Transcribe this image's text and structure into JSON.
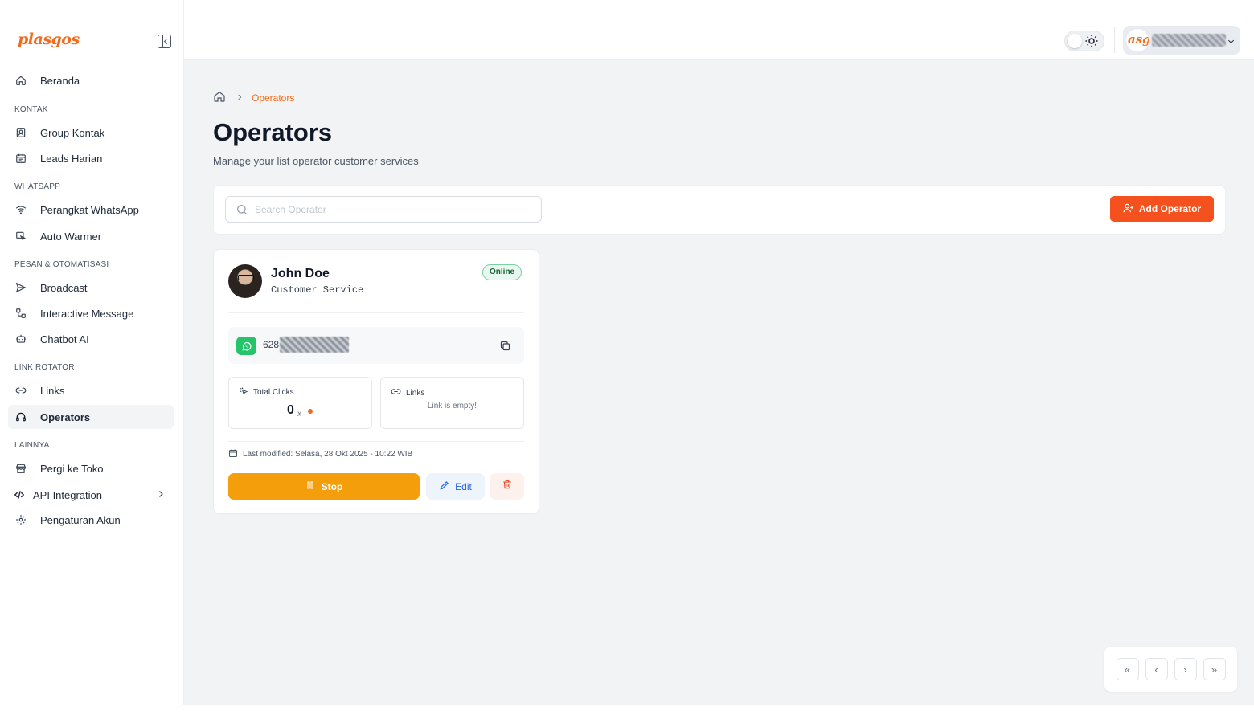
{
  "brand": "plasgos",
  "sidebar": {
    "items": [
      {
        "label": "Beranda",
        "icon": "home-icon"
      },
      {
        "section": "KONTAK"
      },
      {
        "label": "Group Kontak",
        "icon": "contact-icon"
      },
      {
        "label": "Leads Harian",
        "icon": "calendar-icon"
      },
      {
        "section": "WHATSAPP"
      },
      {
        "label": "Perangkat WhatsApp",
        "icon": "wifi-icon"
      },
      {
        "label": "Auto Warmer",
        "icon": "auto-warmer-icon"
      },
      {
        "section": "PESAN & OTOMATISASI"
      },
      {
        "label": "Broadcast",
        "icon": "send-icon"
      },
      {
        "label": "Interactive Message",
        "icon": "interactive-icon"
      },
      {
        "label": "Chatbot AI",
        "icon": "bot-icon"
      },
      {
        "section": "LINK ROTATOR"
      },
      {
        "label": "Links",
        "icon": "link-icon"
      },
      {
        "label": "Operators",
        "icon": "headset-icon",
        "active": true
      },
      {
        "section": "LAINNYA"
      },
      {
        "label": "Pergi ke Toko",
        "icon": "store-icon"
      },
      {
        "label": "API Integration",
        "icon": "code-icon"
      },
      {
        "label": "Pengaturan Akun",
        "icon": "settings-icon"
      }
    ]
  },
  "topbar": {
    "user_logo_text": "asg"
  },
  "breadcrumb": {
    "current": "Operators"
  },
  "page": {
    "title": "Operators",
    "subtitle": "Manage your list operator customer services"
  },
  "toolbar": {
    "search_placeholder": "Search Operator",
    "add_button": "Add Operator"
  },
  "operator": {
    "name": "John Doe",
    "role": "Customer Service",
    "status": "Online",
    "phone_prefix": "628",
    "total_clicks_label": "Total Clicks",
    "total_clicks": "0",
    "clicks_unit": "x",
    "links_label": "Links",
    "links_empty": "Link is empty!",
    "last_modified": "Last modified: Selasa, 28 Okt 2025 - 10:22 WIB",
    "stop_label": "Stop",
    "edit_label": "Edit"
  },
  "pagination": {
    "first": "«",
    "prev": "‹",
    "next": "›",
    "last": "»"
  },
  "colors": {
    "accent": "#f4511e",
    "brand": "#f26a1b",
    "stop": "#f59e0b",
    "online": "#166534",
    "whatsapp": "#25c46b"
  }
}
